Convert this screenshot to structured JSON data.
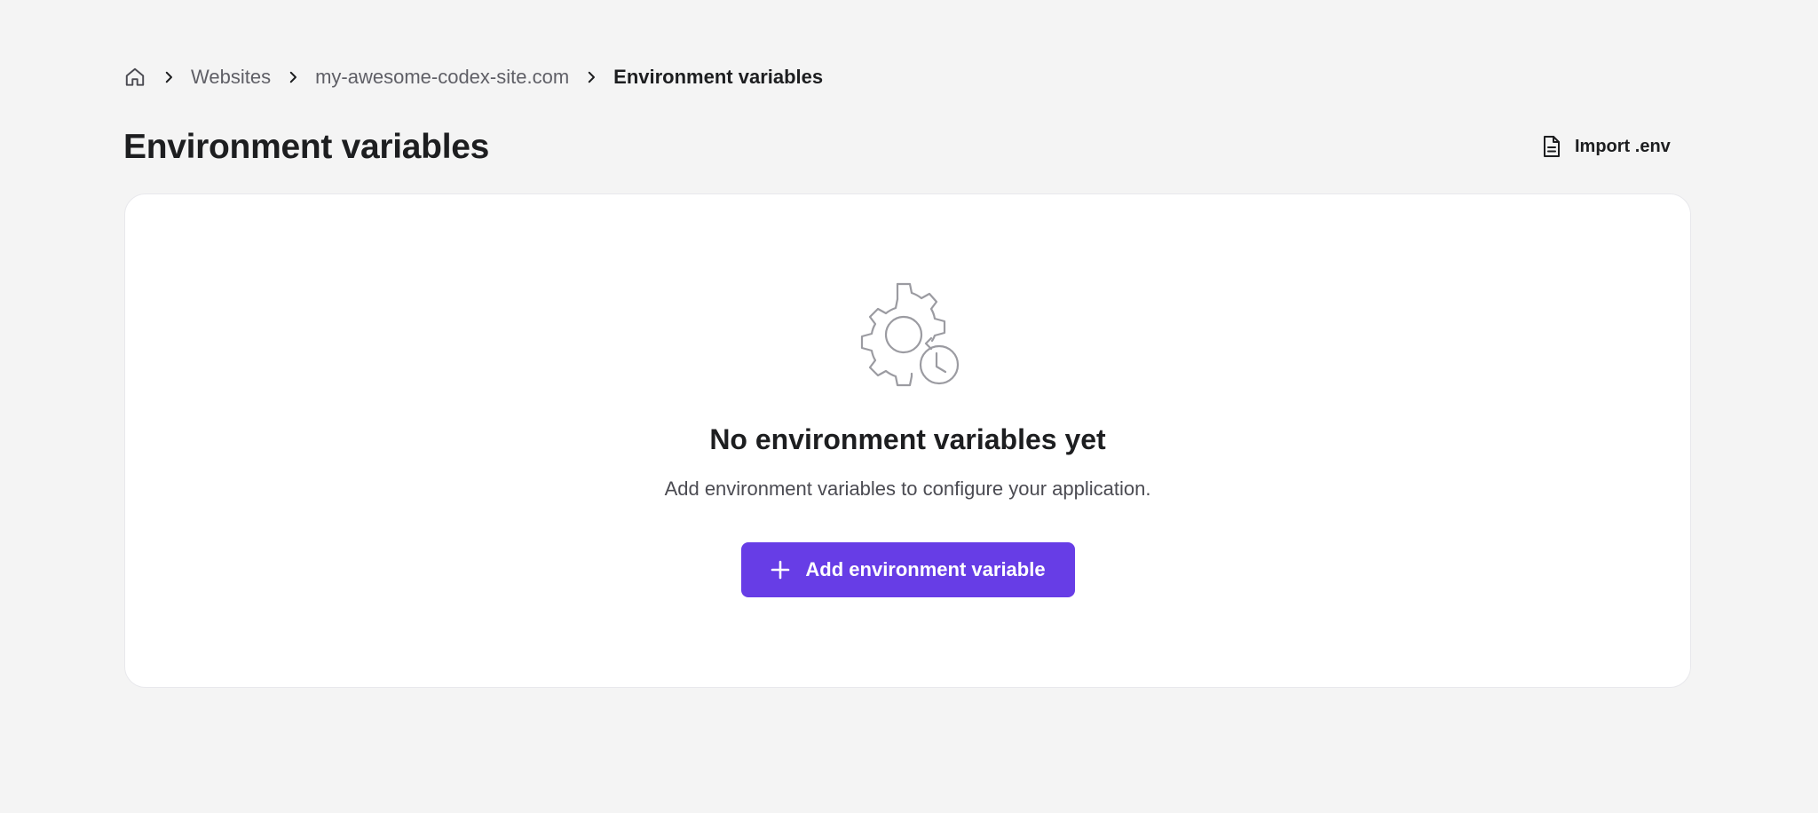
{
  "breadcrumb": {
    "home_icon": "home-icon",
    "separator_icon": "chevron-right-icon",
    "items": [
      {
        "label": "Websites"
      },
      {
        "label": "my-awesome-codex-site.com"
      }
    ],
    "current": "Environment variables"
  },
  "header": {
    "title": "Environment variables",
    "import_icon": "file-document-icon",
    "import_label": "Import .env"
  },
  "empty_state": {
    "icon": "gear-clock-icon",
    "title": "No environment variables yet",
    "description": "Add environment variables to configure your application.",
    "button_icon": "plus-icon",
    "button_label": "Add environment variable"
  },
  "colors": {
    "background": "#f4f4f4",
    "card": "#ffffff",
    "primary": "#673de6",
    "text": "#1d1e20",
    "muted_text": "#5f5f66",
    "icon_gray": "#9b9ba1"
  }
}
